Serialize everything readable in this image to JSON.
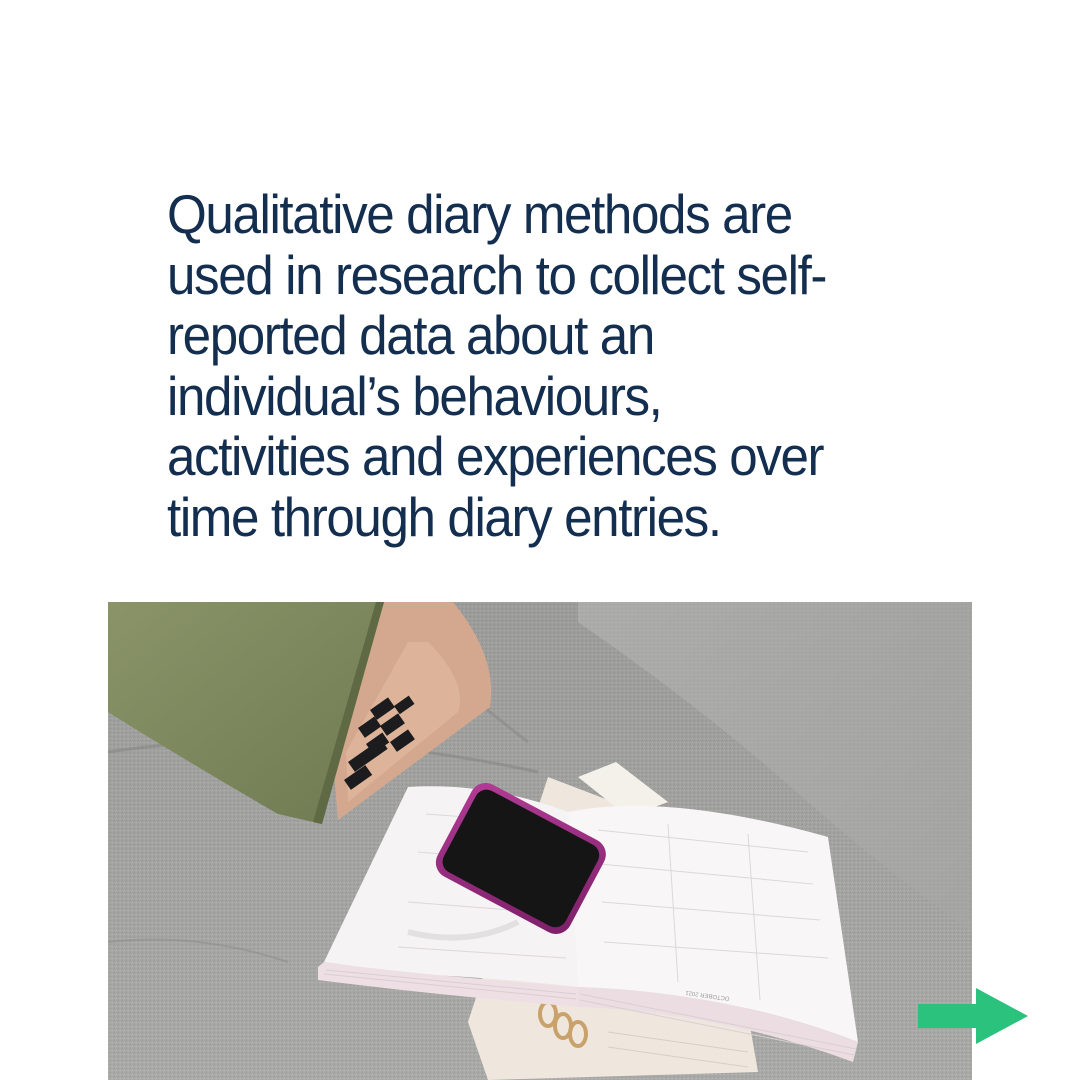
{
  "headline": {
    "lines": [
      "Qualitative diary methods are",
      "used in research to collect self-",
      "reported data about an",
      "individual’s behaviours,",
      "activities and experiences over",
      "time through diary entries."
    ]
  },
  "photo": {
    "scene": "laptop, phone and open diary on a grey sofa",
    "planner_month": "OCTOBER 2021"
  },
  "navigation": {
    "next_icon": "arrow-right-icon"
  },
  "colors": {
    "headline_text": "#132e4f",
    "arrow": "#2bc27e",
    "background": "#ffffff"
  }
}
